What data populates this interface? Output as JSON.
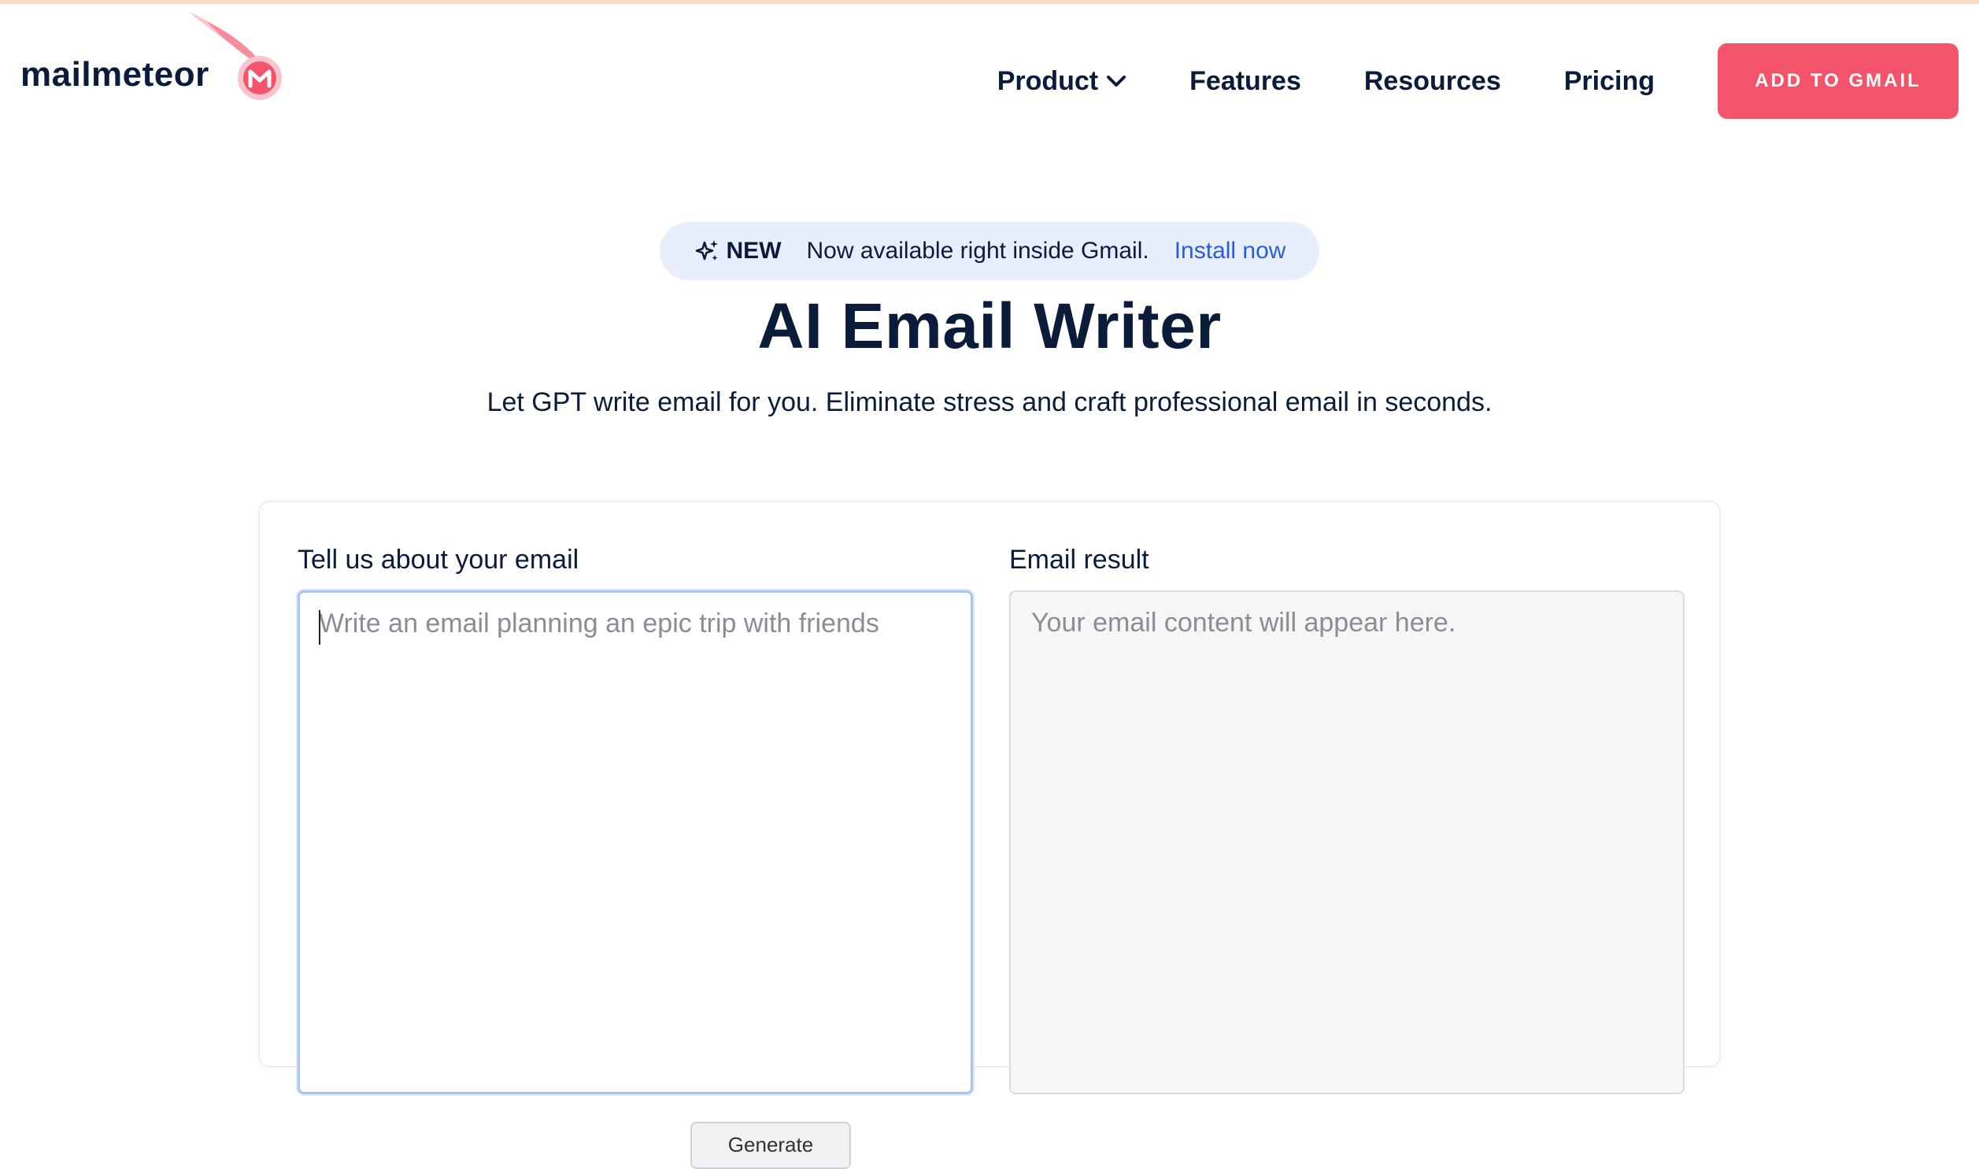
{
  "brand": {
    "name": "mailmeteor",
    "accent": "#f4546b",
    "dark": "#0b1b3a"
  },
  "nav": {
    "items": [
      {
        "label": "Product",
        "has_dropdown": true
      },
      {
        "label": "Features"
      },
      {
        "label": "Resources"
      },
      {
        "label": "Pricing"
      }
    ],
    "cta_label": "ADD TO GMAIL"
  },
  "announcement": {
    "icon": "sparkle-icon",
    "tag": "NEW",
    "message": "Now available right inside Gmail.",
    "link": "Install now",
    "link_color": "#2b5dd6"
  },
  "hero": {
    "title": "AI Email Writer",
    "subtitle": "Let GPT write email for you. Eliminate stress and craft professional email in seconds."
  },
  "form": {
    "input_label": "Tell us about your email",
    "input_placeholder": "Write an email planning an epic trip with friends",
    "input_value": "",
    "output_label": "Email result",
    "output_placeholder": "Your email content will appear here.",
    "generate_label": "Generate"
  }
}
